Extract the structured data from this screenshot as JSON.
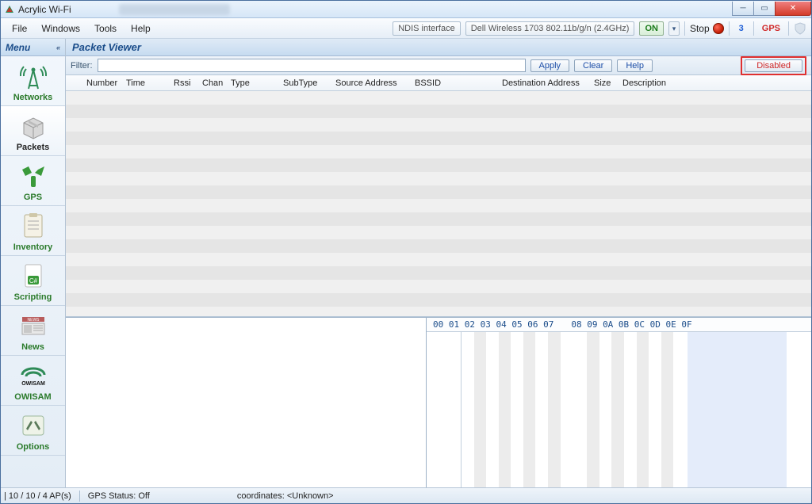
{
  "window": {
    "title": "Acrylic Wi-Fi"
  },
  "menubar": {
    "items": [
      "File",
      "Windows",
      "Tools",
      "Help"
    ]
  },
  "toolbar": {
    "interface_label": "NDIS interface",
    "adapter": "Dell Wireless 1703 802.11b/g/n (2.4GHz)",
    "on_label": "ON",
    "stop_label": "Stop",
    "count": "3",
    "gps_label": "GPS"
  },
  "sidemenu": {
    "header": "Menu",
    "items": [
      {
        "label": "Networks"
      },
      {
        "label": "Packets"
      },
      {
        "label": "GPS"
      },
      {
        "label": "Inventory"
      },
      {
        "label": "Scripting"
      },
      {
        "label": "News"
      },
      {
        "label": "OWISAM"
      },
      {
        "label": "Options"
      }
    ]
  },
  "main": {
    "title": "Packet Viewer",
    "filter_label": "Filter:",
    "filter_value": "",
    "apply": "Apply",
    "clear": "Clear",
    "help": "Help",
    "disabled": "Disabled",
    "columns": [
      "Number",
      "Time",
      "Rssi",
      "Chan",
      "Type",
      "SubType",
      "Source Address",
      "BSSID",
      "Destination Address",
      "Size",
      "Description"
    ]
  },
  "hex": {
    "header_a": "00 01 02 03 04 05 06 07",
    "header_b": "08 09 0A 0B 0C 0D 0E 0F"
  },
  "status": {
    "aps": "| 10 / 10 / 4 AP(s)",
    "gps": "GPS Status: Off",
    "coords": "coordinates: <Unknown>"
  }
}
